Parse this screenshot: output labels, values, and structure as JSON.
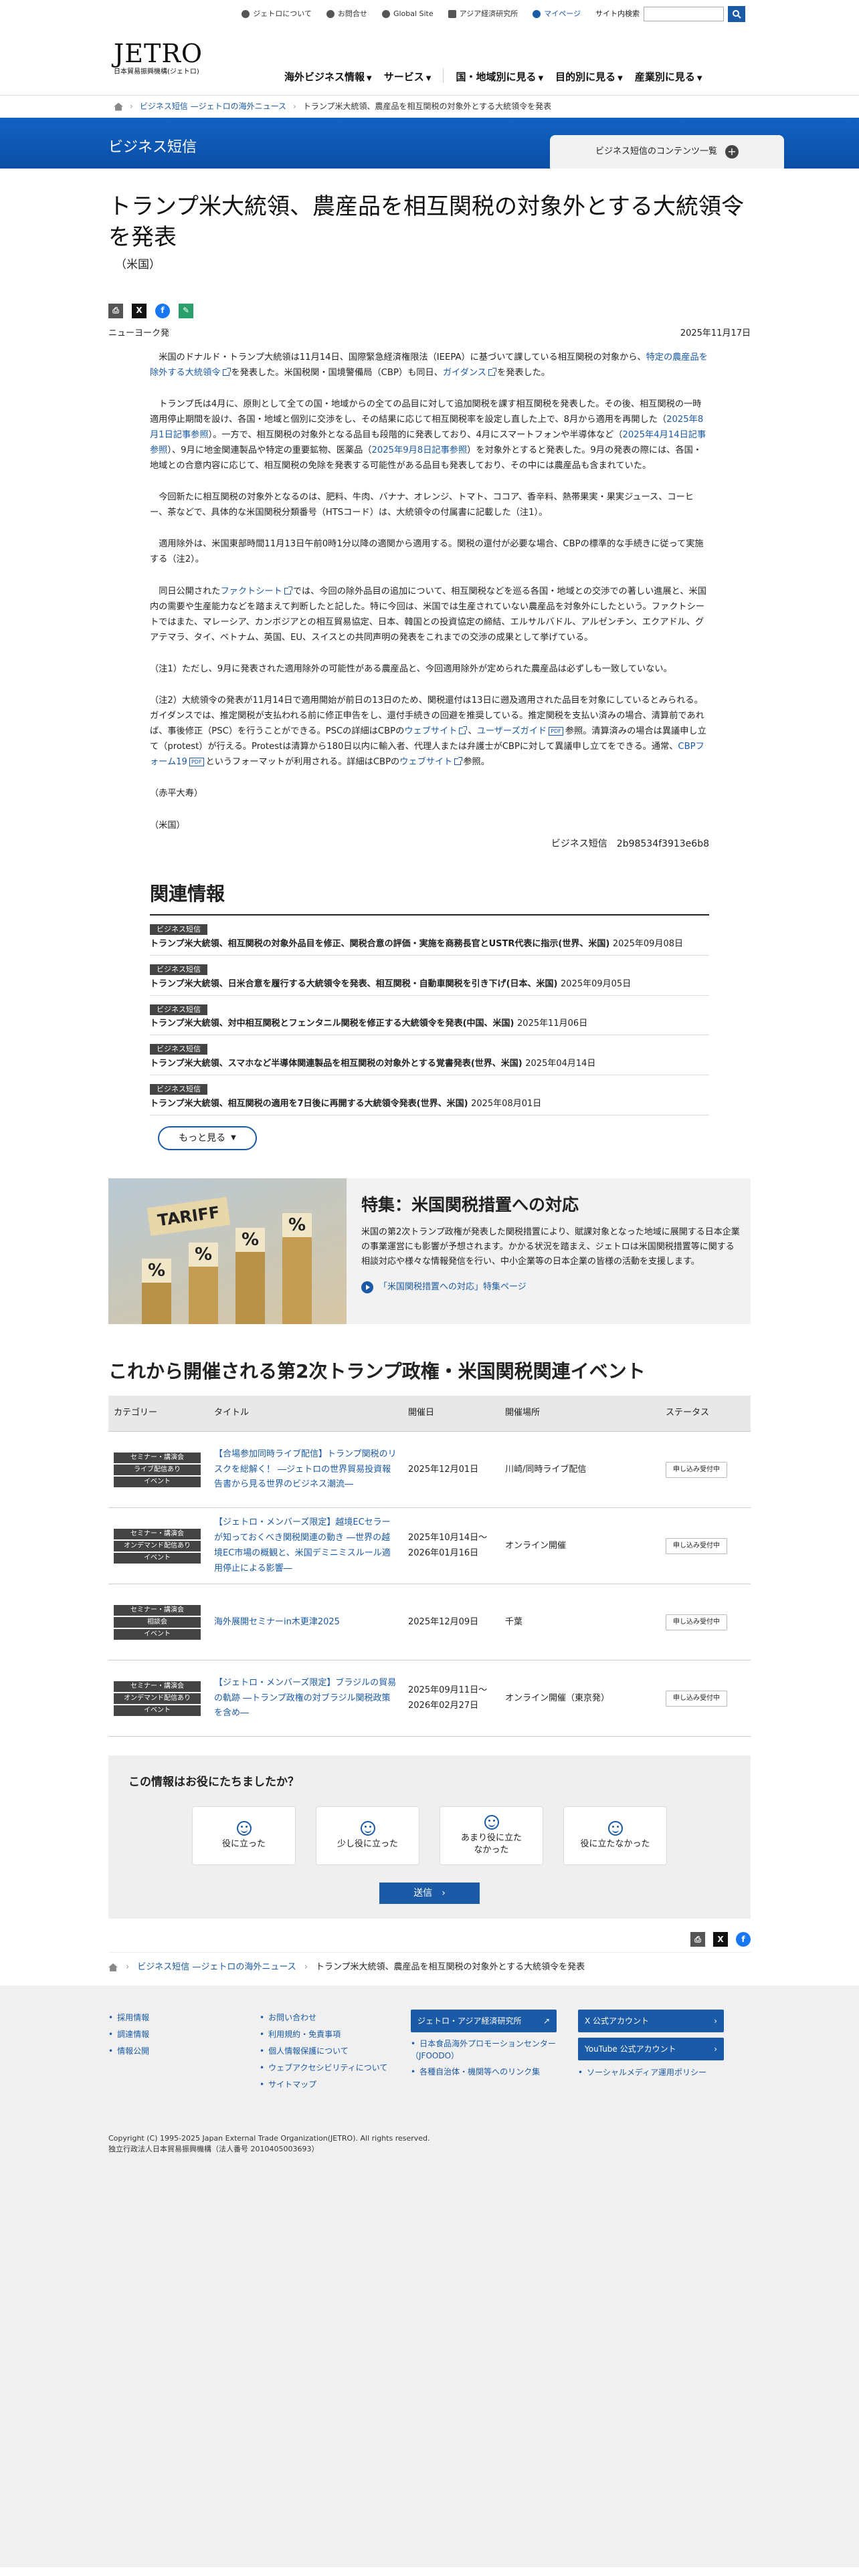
{
  "util": {
    "links": [
      "ジェトロについて",
      "お問合せ",
      "Global Site",
      "アジア経済研究所",
      "マイページ"
    ],
    "search_label": "サイト内検索",
    "search_placeholder": ""
  },
  "header": {
    "logo": "JETRO",
    "logo_sub": "日本貿易振興機構(ジェトロ)",
    "nav": [
      "海外ビジネス情報",
      "サービス",
      "国・地域別に見る",
      "目的別に見る",
      "産業別に見る"
    ]
  },
  "breadcrumb": [
    "ビジネス短信 —ジェトロの海外ニュース",
    "トランプ米大統領、農産品を相互関税の対象外とする大統領令を発表"
  ],
  "banner": {
    "title": "ビジネス短信",
    "menu": "ビジネス短信のコンテンツ一覧"
  },
  "article": {
    "title": "トランプ米大統領、農産品を相互関税の対象外とする大統領令を発表",
    "country": "（米国）",
    "location": "ニューヨーク発",
    "date": "2025年11月17日",
    "p1a": "米国のドナルド・トランプ大統領は11月14日、国際緊急経済権限法（IEEPA）に基づいて課している相互関税の対象から、",
    "p1_link": "特定の農産品を除外する大統領令",
    "p1b": "を発表した。米国税関・国境警備局（CBP）も同日、",
    "p1_link2": "ガイダンス",
    "p1c": "を発表した。",
    "p2a": "トランプ氏は4月に、原則として全ての国・地域からの全ての品目に対して追加関税を課す相互関税を発表した。その後、相互関税の一時適用停止期間を設け、各国・地域と個別に交渉をし、その結果に応じて相互関税率を設定し直した上で、8月から適用を再開した（",
    "p2_link": "2025年8月1日記事参照",
    "p2b": "）。一方で、相互関税の対象外となる品目も段階的に発表しており、4月にスマートフォンや半導体など（",
    "p2_link2": "2025年4月14日記事参照",
    "p2c": "）、9月に地金関連製品や特定の重要鉱物、医薬品（",
    "p2_link3": "2025年9月8日記事参照",
    "p2d": "）を対象外とすると発表した。9月の発表の際には、各国・地域との合意内容に応じて、相互関税の免除を発表する可能性がある品目も発表しており、その中には農産品も含まれていた。",
    "p3": "今回新たに相互関税の対象外となるのは、肥料、牛肉、バナナ、オレンジ、トマト、ココア、香辛料、熱帯果実・果実ジュース、コーヒー、茶などで、具体的な米国関税分類番号（HTSコード）は、大統領令の付属書に記載した（注1）。",
    "p4": "適用除外は、米国東部時間11月13日午前0時1分以降の適関から適用する。関税の還付が必要な場合、CBPの標準的な手続きに従って実施する（注2）。",
    "p5a": "同日公開された",
    "p5_link": "ファクトシート",
    "p5b": "では、今回の除外品目の追加について、相互関税などを巡る各国・地域との交渉での著しい進展と、米国内の需要や生産能力などを踏まえて判断したと記した。特に今回は、米国では生産されていない農産品を対象外にしたという。ファクトシートではまた、マレーシア、カンボジアとの相互貿易協定、日本、韓国との投資協定の締結、エルサルバドル、アルゼンチン、エクアドル、グアテマラ、タイ、ベトナム、英国、EU、スイスとの共同声明の発表をこれまでの交渉の成果として挙げている。",
    "n1": "（注1）ただし、9月に発表された適用除外の可能性がある農産品と、今回適用除外が定められた農産品は必ずしも一致していない。",
    "n2a": "（注2）大統領令の発表が11月14日で適用開始が前日の13日のため、関税還付は13日に遡及適用された品目を対象にしているとみられる。ガイダンスでは、推定関税が支払われる前に修正申告をし、還付手続きの回避を推奨している。推定関税を支払い済みの場合、清算前であれば、事後修正（PSC）を行うことができる。PSCの詳細はCBPの",
    "n2_link1": "ウェブサイト",
    "n2b": "、",
    "n2_link2": "ユーザーズガイド",
    "n2c": "参照。清算済みの場合は異議申し立て（protest）が行える。Protestは清算から180日以内に輸入者、代理人または弁護士がCBPに対して異議申し立てをできる。通常、",
    "n2_link3": "CBPフォーム19",
    "n2d": "というフォーマットが利用される。詳細はCBPの",
    "n2_link4": "ウェブサイト",
    "n2e": "参照。",
    "author": "（赤平大寿）",
    "region": "（米国）",
    "signature": "ビジネス短信　2b98534f3913e6b8"
  },
  "related": {
    "heading": "関連情報",
    "items": [
      {
        "tag": "ビジネス短信",
        "title": "トランプ米大統領、相互関税の対象外品目を修正、関税合意の評価・実施を商務長官とUSTR代表に指示(世界、米国)",
        "date": "2025年09月08日"
      },
      {
        "tag": "ビジネス短信",
        "title": "トランプ米大統領、日米合意を履行する大統領令を発表、相互関税・自動車関税を引き下げ(日本、米国)",
        "date": "2025年09月05日"
      },
      {
        "tag": "ビジネス短信",
        "title": "トランプ米大統領、対中相互関税とフェンタニル関税を修正する大統領令を発表(中国、米国)",
        "date": "2025年11月06日"
      },
      {
        "tag": "ビジネス短信",
        "title": "トランプ米大統領、スマホなど半導体関連製品を相互関税の対象外とする覚書発表(世界、米国)",
        "date": "2025年04月14日"
      },
      {
        "tag": "ビジネス短信",
        "title": "トランプ米大統領、相互関税の適用を7日後に再開する大統領令発表(世界、米国)",
        "date": "2025年08月01日"
      }
    ],
    "more": "もっと見る"
  },
  "feature": {
    "image_label": "TARIFF",
    "title": "特集：米国関税措置への対応",
    "desc": "米国の第2次トランプ政権が発表した関税措置により、賦課対象となった地域に展開する日本企業の事業運営にも影響が予想されます。かかる状況を踏まえ、ジェトロは米国関税措置等に関する相談対応や様々な情報発信を行い、中小企業等の日本企業の皆様の活動を支援します。",
    "link": "「米国関税措置への対応」特集ページ"
  },
  "events": {
    "heading": "これから開催される第2次トランプ政権・米国関税関連イベント",
    "columns": [
      "カテゴリー",
      "タイトル",
      "開催日",
      "開催場所",
      "ステータス"
    ],
    "rows": [
      {
        "cats": [
          "セミナー・講演会",
          "ライブ配信あり",
          "イベント"
        ],
        "title": "【合場参加同時ライブ配信】トランプ関税のリスクを総解く！ ―ジェトロの世界貿易投資報告書から見る世界のビジネス潮流―",
        "date": "2025年12月01日",
        "place": "川崎/同時ライブ配信",
        "status": "申し込み受付中"
      },
      {
        "cats": [
          "セミナー・講演会",
          "オンデマンド配信あり",
          "イベント"
        ],
        "title": "【ジェトロ・メンバーズ限定】越境ECセラーが知っておくべき関税関連の動き ―世界の越境EC市場の概観と、米国デミニミスルール適用停止による影響―",
        "date": "2025年10月14日〜2026年01月16日",
        "place": "オンライン開催",
        "status": "申し込み受付中"
      },
      {
        "cats": [
          "セミナー・講演会",
          "相談会",
          "イベント"
        ],
        "title": "海外展開セミナーin木更津2025",
        "date": "2025年12月09日",
        "place": "千葉",
        "status": "申し込み受付中"
      },
      {
        "cats": [
          "セミナー・講演会",
          "オンデマンド配信あり",
          "イベント"
        ],
        "title": "【ジェトロ・メンバーズ限定】ブラジルの貿易の軌跡 ―トランプ政権の対ブラジル関税政策を含め―",
        "date": "2025年09月11日〜2026年02月27日",
        "place": "オンライン開催（東京発）",
        "status": "申し込み受付中"
      }
    ]
  },
  "feedback": {
    "heading": "この情報はお役にたちましたか？",
    "options": [
      "役に立った",
      "少し役に立った",
      "あまり役に立たなかった",
      "役に立たなかった"
    ],
    "send": "送信"
  },
  "footer": {
    "col1": [
      "採用情報",
      "調達情報",
      "情報公開"
    ],
    "col2": [
      "お問い合わせ",
      "利用規約・免責事項",
      "個人情報保護について",
      "ウェブアクセシビリティについて",
      "サイトマップ"
    ],
    "col3_btn": "ジェトロ・アジア経済研究所",
    "col3": [
      "日本食品海外プロモーションセンター（JFOODO）",
      "各種自治体・機関等へのリンク集"
    ],
    "col4_btn1": "X 公式アカウント",
    "col4_btn2": "YouTube 公式アカウント",
    "col4": [
      "ソーシャルメディア運用ポリシー"
    ],
    "copyright": "Copyright (C) 1995-2025 Japan External Trade Organization(JETRO). All rights reserved.",
    "corp": "独立行政法人日本貿易振興機構（法人番号 2010405003693）"
  }
}
